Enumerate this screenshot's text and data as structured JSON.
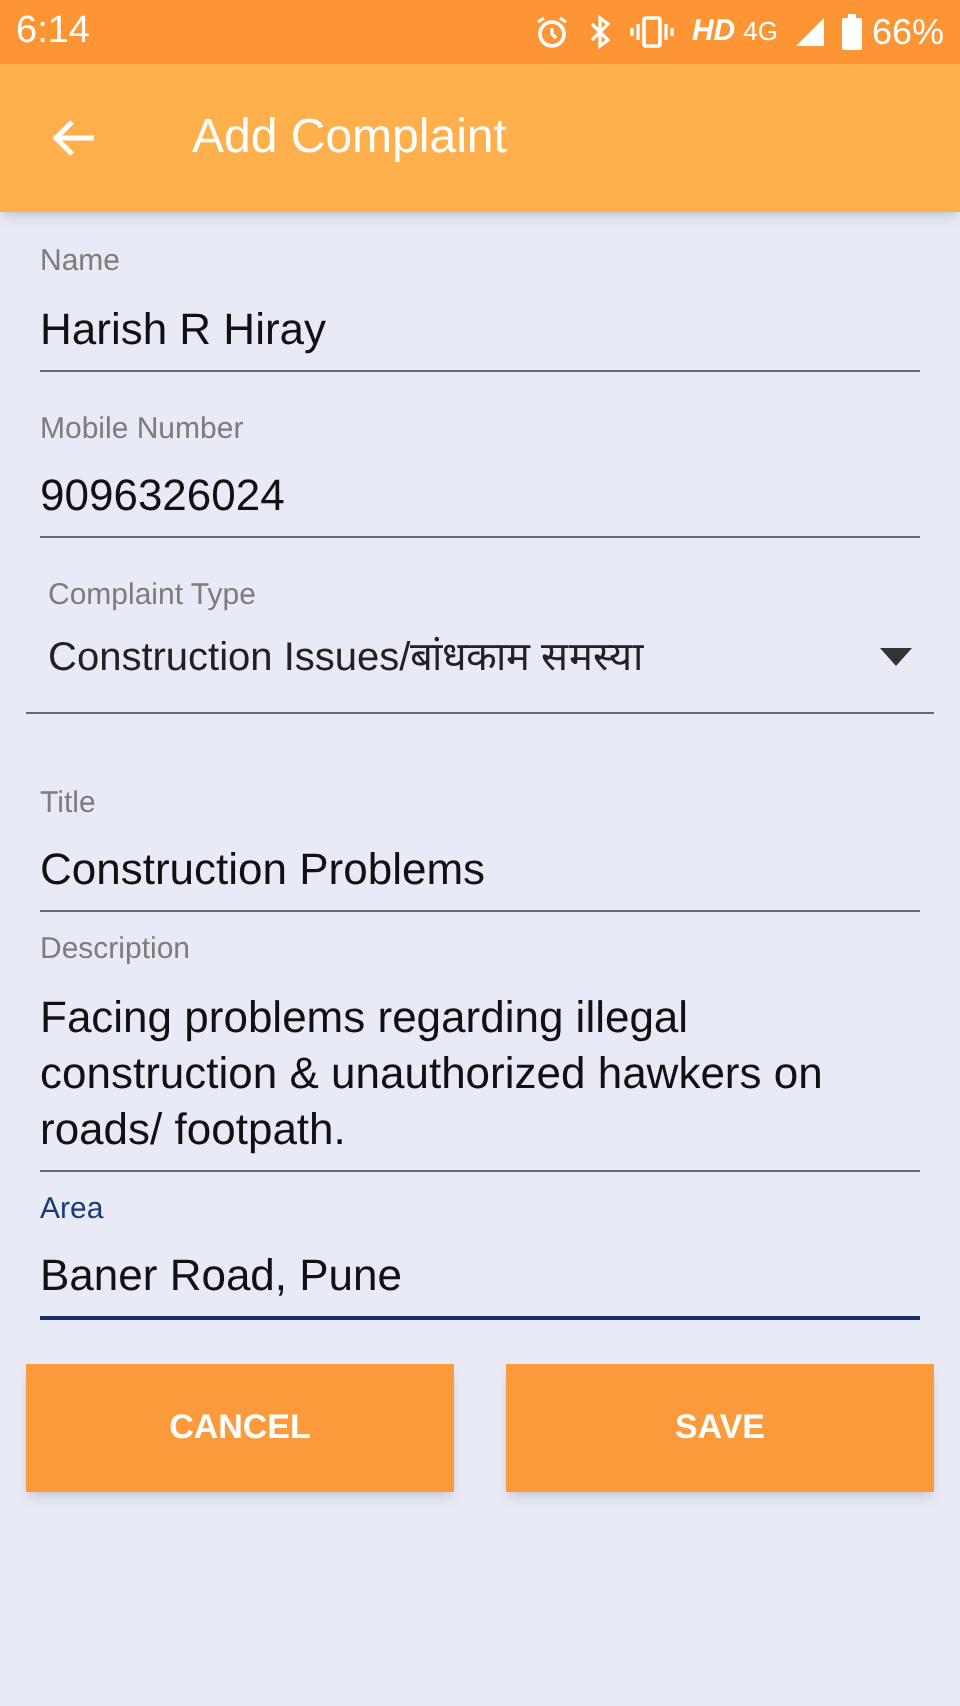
{
  "status_bar": {
    "time": "6:14",
    "network": "HD",
    "network_type": "4G",
    "battery": "66%"
  },
  "app_bar": {
    "title": "Add Complaint"
  },
  "fields": [
    {
      "kind": "text",
      "label": "Name",
      "value": "Harish R Hiray",
      "focused": false
    },
    {
      "kind": "text",
      "label": "Mobile Number",
      "value": "9096326024",
      "focused": false
    },
    {
      "kind": "select",
      "label": "Complaint Type",
      "value": "Construction Issues/बांधकाम समस्या",
      "focused": false
    },
    {
      "kind": "text",
      "label": "Title",
      "value": "Construction Problems",
      "focused": false
    },
    {
      "kind": "text",
      "label": "Description",
      "value": "Facing problems regarding illegal construction & unauthorized hawkers on roads/ footpath.",
      "focused": false
    },
    {
      "kind": "text",
      "label": "Area",
      "value": "Baner Road, Pune",
      "focused": true
    }
  ],
  "buttons": [
    "CANCEL",
    "SAVE"
  ]
}
